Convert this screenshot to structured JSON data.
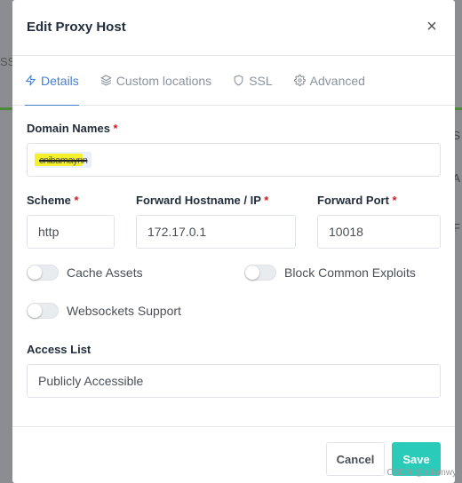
{
  "modal": {
    "title": "Edit Proxy Host",
    "close_icon": "close-icon"
  },
  "tabs": [
    {
      "label": "Details",
      "icon": "lightning-icon",
      "active": true
    },
    {
      "label": "Custom locations",
      "icon": "layers-icon",
      "active": false
    },
    {
      "label": "SSL",
      "icon": "shield-icon",
      "active": false
    },
    {
      "label": "Advanced",
      "icon": "gear-icon",
      "active": false
    }
  ],
  "form": {
    "domain_names": {
      "label": "Domain Names",
      "required_mark": "*",
      "value": "cnibamaynn"
    },
    "scheme": {
      "label": "Scheme",
      "required_mark": "*",
      "value": "http"
    },
    "forward_hostname": {
      "label": "Forward Hostname / IP",
      "required_mark": "*",
      "value": "172.17.0.1"
    },
    "forward_port": {
      "label": "Forward Port",
      "required_mark": "*",
      "value": "10018"
    },
    "toggles": {
      "cache_assets": {
        "label": "Cache Assets",
        "on": false
      },
      "block_exploits": {
        "label": "Block Common Exploits",
        "on": false
      },
      "websockets": {
        "label": "Websockets Support",
        "on": false
      }
    },
    "access_list": {
      "label": "Access List",
      "value": "Publicly Accessible"
    }
  },
  "footer": {
    "cancel_label": "Cancel",
    "save_label": "Save"
  },
  "background": {
    "left_fragment": "SSl",
    "right_chars": [
      "S",
      "A",
      "F"
    ]
  },
  "watermark": "CSDN @adamwy",
  "colors": {
    "accent": "#467fcf",
    "save": "#2bcbba",
    "required": "#cd201f",
    "highlight": "#f5ef12"
  }
}
